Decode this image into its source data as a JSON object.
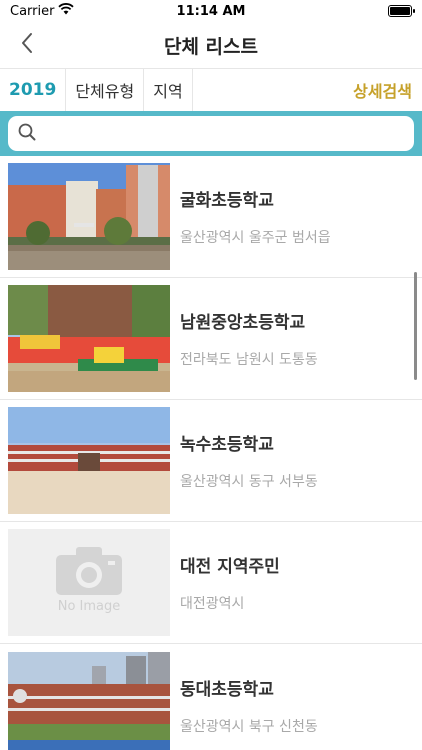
{
  "status_bar": {
    "carrier": "Carrier",
    "time": "11:14 AM"
  },
  "nav": {
    "title": "단체 리스트"
  },
  "filters": {
    "year": "2019",
    "type": "단체유형",
    "region": "지역",
    "detail_search": "상세검색"
  },
  "search": {
    "placeholder": ""
  },
  "groups": [
    {
      "name": "굴화초등학교",
      "location": "울산광역시 울주군 범서읍"
    },
    {
      "name": "남원중앙초등학교",
      "location": "전라북도 남원시 도통동"
    },
    {
      "name": "녹수초등학교",
      "location": "울산광역시 동구 서부동"
    },
    {
      "name": "대전 지역주민",
      "location": "대전광역시",
      "no_image_label": "No Image"
    },
    {
      "name": "동대초등학교",
      "location": "울산광역시 북구 신천동"
    }
  ],
  "colors": {
    "accent": "#1e9bb0",
    "search_bg": "#56b9c9",
    "detail_search": "#c6a12a"
  },
  "icons": {
    "back": "chevron-left-icon",
    "search": "search-icon",
    "wifi": "wifi-icon",
    "battery": "battery-icon"
  }
}
